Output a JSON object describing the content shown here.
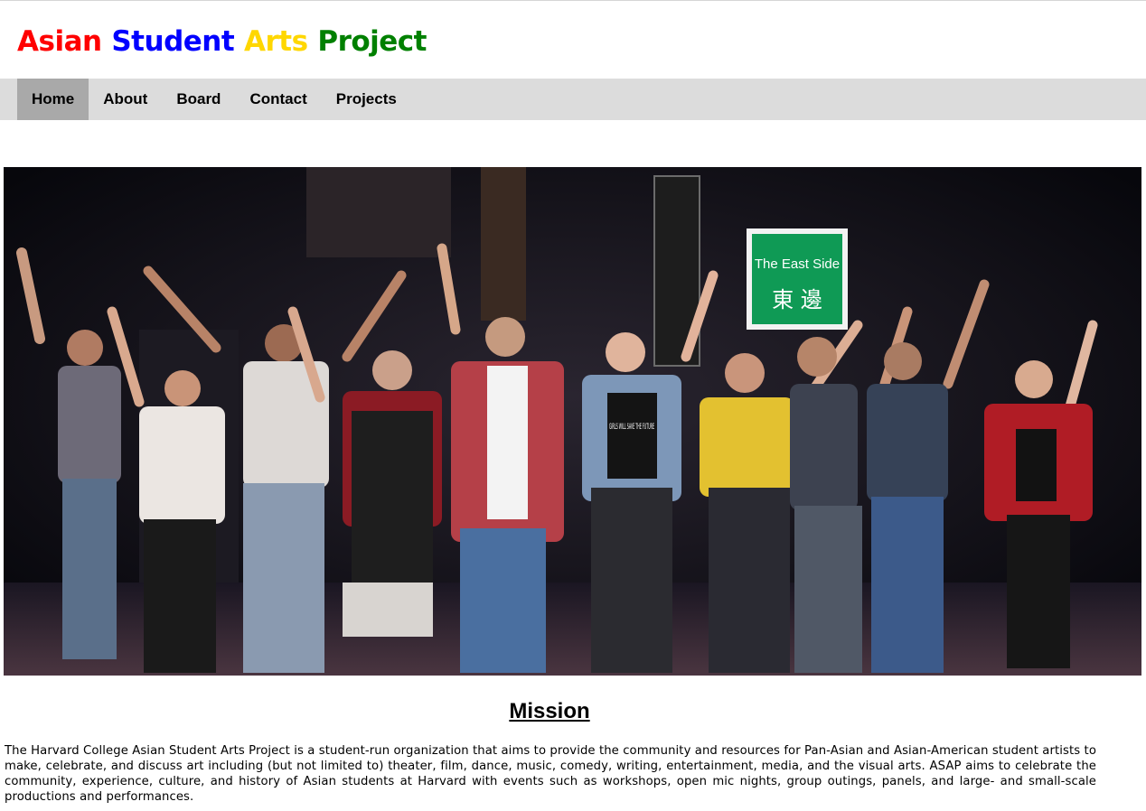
{
  "header": {
    "title_words": [
      {
        "text": "Asian",
        "color": "#ff0000"
      },
      {
        "text": "Student",
        "color": "#0000ff"
      },
      {
        "text": "Arts",
        "color": "#ffd700"
      },
      {
        "text": "Project",
        "color": "#008000"
      }
    ]
  },
  "nav": {
    "items": [
      {
        "label": "Home",
        "active": true
      },
      {
        "label": "About",
        "active": false
      },
      {
        "label": "Board",
        "active": false
      },
      {
        "label": "Contact",
        "active": false
      },
      {
        "label": "Projects",
        "active": false
      }
    ],
    "active_color": "#a9a9a9",
    "bar_color": "#dcdcdc"
  },
  "hero": {
    "sign_title": "The East Side",
    "sign_chars": "東 邊",
    "shirt_text": "GIRLS WILL SAVE THE FUTURE",
    "icon": "stage-cast-photo"
  },
  "mission": {
    "heading": "Mission",
    "body": "The Harvard College Asian Student Arts Project is a student-run organization that aims to provide the community and resources for Pan-Asian and Asian-American student artists to make, celebrate, and discuss art including (but not limited to) theater, film, dance, music, comedy, writing, entertainment, media, and the visual arts. ASAP aims to celebrate the community, experience, culture, and history of Asian students at Harvard with events such as workshops, open mic nights, group outings, panels, and large- and small-scale productions and performances."
  }
}
